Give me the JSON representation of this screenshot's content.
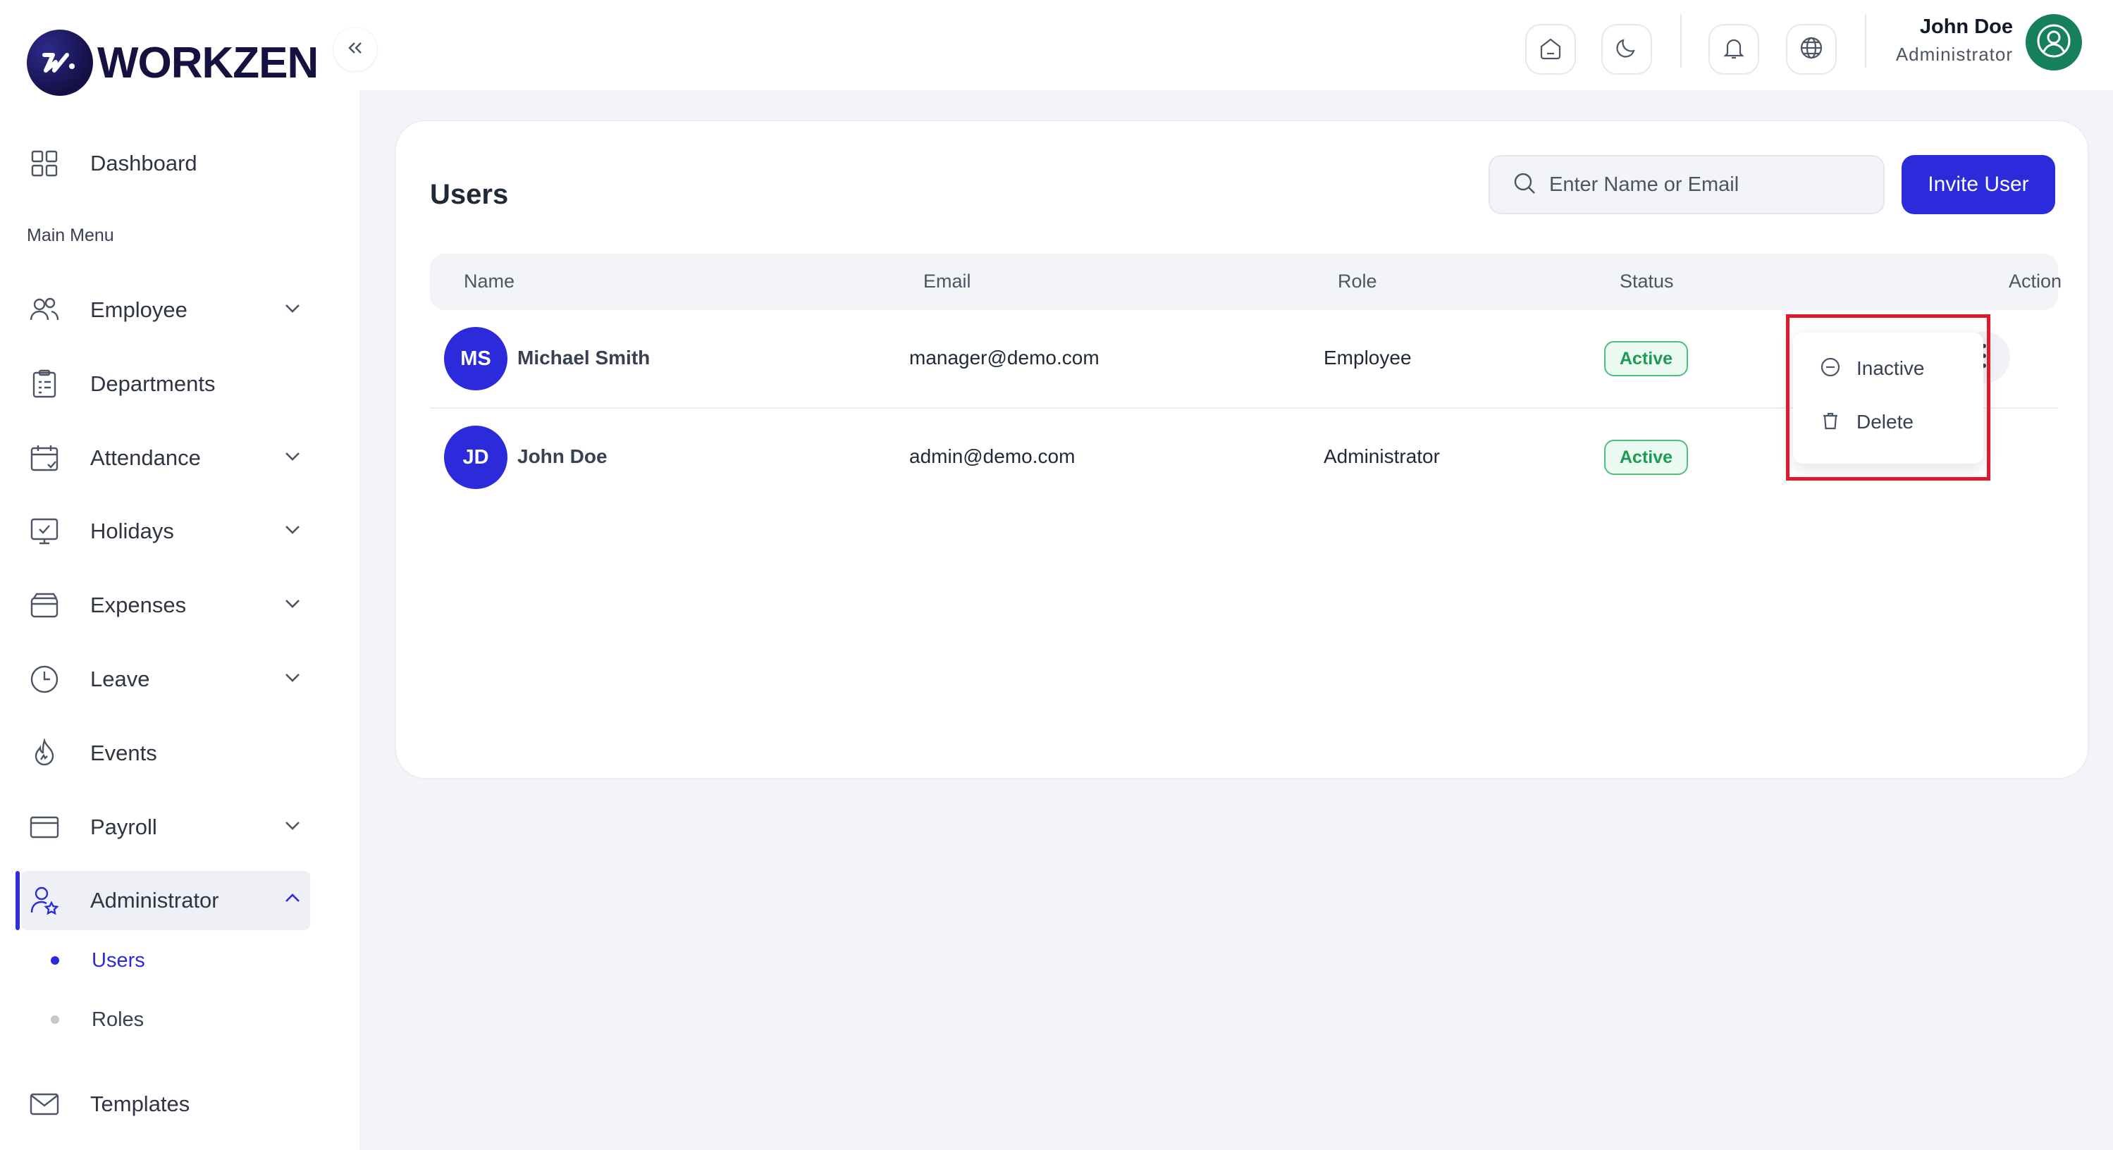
{
  "brand": {
    "name": "WORKZEN"
  },
  "sidebar": {
    "dashboard": "Dashboard",
    "section": "Main Menu",
    "items": [
      {
        "label": "Employee",
        "icon": "users-icon",
        "expandable": true
      },
      {
        "label": "Departments",
        "icon": "clipboard-icon",
        "expandable": false
      },
      {
        "label": "Attendance",
        "icon": "calendar-check-icon",
        "expandable": true
      },
      {
        "label": "Holidays",
        "icon": "monitor-check-icon",
        "expandable": true
      },
      {
        "label": "Expenses",
        "icon": "wallet-icon",
        "expandable": true
      },
      {
        "label": "Leave",
        "icon": "clock-icon",
        "expandable": true
      },
      {
        "label": "Events",
        "icon": "flame-icon",
        "expandable": false
      },
      {
        "label": "Payroll",
        "icon": "credit-card-icon",
        "expandable": true
      },
      {
        "label": "Administrator",
        "icon": "user-star-icon",
        "expandable": true,
        "active": true
      },
      {
        "label": "Templates",
        "icon": "mail-icon",
        "expandable": false
      }
    ],
    "admin_sub": [
      {
        "label": "Users",
        "active": true
      },
      {
        "label": "Roles",
        "active": false
      }
    ]
  },
  "topbar": {
    "user_name": "John Doe",
    "user_role": "Administrator"
  },
  "page": {
    "title": "Users",
    "search_placeholder": "Enter Name or Email",
    "invite_label": "Invite User"
  },
  "table": {
    "columns": [
      "Name",
      "Email",
      "Role",
      "Status",
      "Action"
    ],
    "rows": [
      {
        "initials": "MS",
        "name": "Michael Smith",
        "email": "manager@demo.com",
        "role": "Employee",
        "status": "Active"
      },
      {
        "initials": "JD",
        "name": "John Doe",
        "email": "admin@demo.com",
        "role": "Administrator",
        "status": "Active"
      }
    ]
  },
  "action_menu": {
    "items": [
      "Inactive",
      "Delete"
    ]
  },
  "colors": {
    "accent": "#2b2bdb",
    "active_badge": "#1f9a55",
    "highlight": "#e0192b",
    "avatar_green": "#16805c"
  }
}
